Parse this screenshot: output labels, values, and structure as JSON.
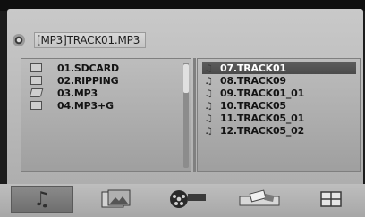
{
  "header": {
    "path": "[MP3]TRACK01.MP3",
    "icon": "disc-icon"
  },
  "left_panel": {
    "items": [
      {
        "label": "01.SDCARD",
        "icon": "folder-icon"
      },
      {
        "label": "02.RIPPING",
        "icon": "folder-icon"
      },
      {
        "label": "03.MP3",
        "icon": "folder-open-icon"
      },
      {
        "label": "04.MP3+G",
        "icon": "folder-icon"
      }
    ]
  },
  "right_panel": {
    "items": [
      {
        "label": "07.TRACK01",
        "icon": "music-note-icon",
        "selected": true
      },
      {
        "label": "08.TRACK09",
        "icon": "music-note-icon"
      },
      {
        "label": "09.TRACK01_01",
        "icon": "music-note-icon"
      },
      {
        "label": "10.TRACK05",
        "icon": "music-note-icon"
      },
      {
        "label": "11.TRACK05_01",
        "icon": "music-note-icon"
      },
      {
        "label": "12.TRACK05_02",
        "icon": "music-note-icon"
      }
    ]
  },
  "toolbar": {
    "buttons": [
      {
        "name": "music",
        "icon": "music-note-icon"
      },
      {
        "name": "photos",
        "icon": "photo-icon"
      },
      {
        "name": "movie",
        "icon": "film-reel-icon"
      },
      {
        "name": "cards",
        "icon": "card-reader-icon"
      },
      {
        "name": "grid",
        "icon": "grid-icon"
      }
    ]
  },
  "colors": {
    "background": "#1c1c1c",
    "screen": "#bdbdbd",
    "selected": "#555555",
    "text": "#141414",
    "selected_text": "#ffffff"
  }
}
